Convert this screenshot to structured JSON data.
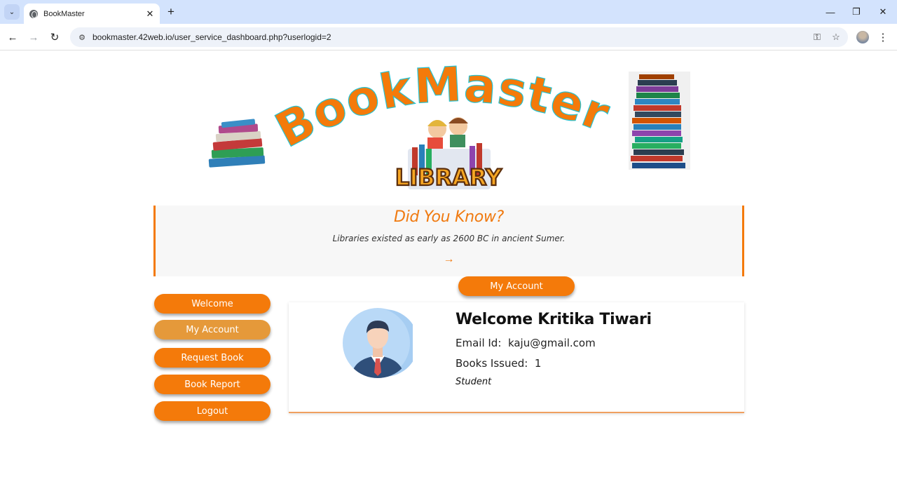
{
  "browser": {
    "tab_title": "BookMaster",
    "url": "bookmaster.42web.io/user_service_dashboard.php?userlogid=2",
    "new_tab": "+",
    "tab_close": "✕",
    "minimize": "—",
    "restore": "❐",
    "close": "✕",
    "back": "←",
    "forward": "→",
    "reload": "↻",
    "site_info": "⚙",
    "key_icon": "⚿",
    "star_icon": "☆",
    "menu": "⋮",
    "dropdown": "⌄"
  },
  "logo": {
    "title": "BookMaster",
    "sub": "LIBRARY"
  },
  "fact": {
    "title": "Did You Know?",
    "text": "Libraries existed as early as 2600 BC in ancient Sumer.",
    "arrow": "→"
  },
  "top_button": "My Account",
  "sidebar": {
    "items": [
      {
        "label": "Welcome"
      },
      {
        "label": "My Account"
      },
      {
        "label": "Request Book"
      },
      {
        "label": "Book Report"
      },
      {
        "label": "Logout"
      }
    ]
  },
  "profile": {
    "welcome": "Welcome Kritika Tiwari",
    "email_label": "Email Id:",
    "email": "kaju@gmail.com",
    "books_label": "Books Issued:",
    "books": "1",
    "role": "Student"
  },
  "colors": {
    "accent": "#f47a0a",
    "active": "#e5993a",
    "tabbar": "#d3e3fd"
  }
}
